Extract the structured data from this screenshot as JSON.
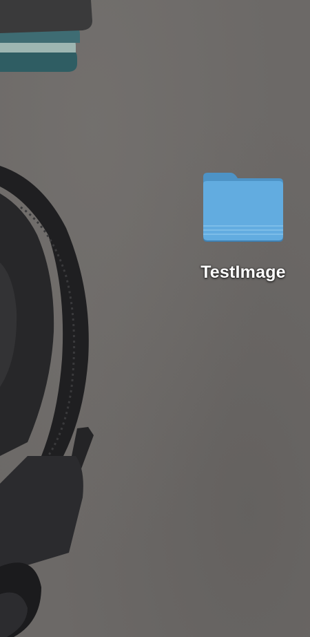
{
  "desktop": {
    "wallpaper": {
      "base_color": "#6c6967",
      "objects": [
        "notebook-stack",
        "headphones"
      ]
    },
    "icons": [
      {
        "label": "TestImage",
        "kind": "folder",
        "icon": "folder-icon",
        "color": "#5fa9dc"
      }
    ]
  }
}
